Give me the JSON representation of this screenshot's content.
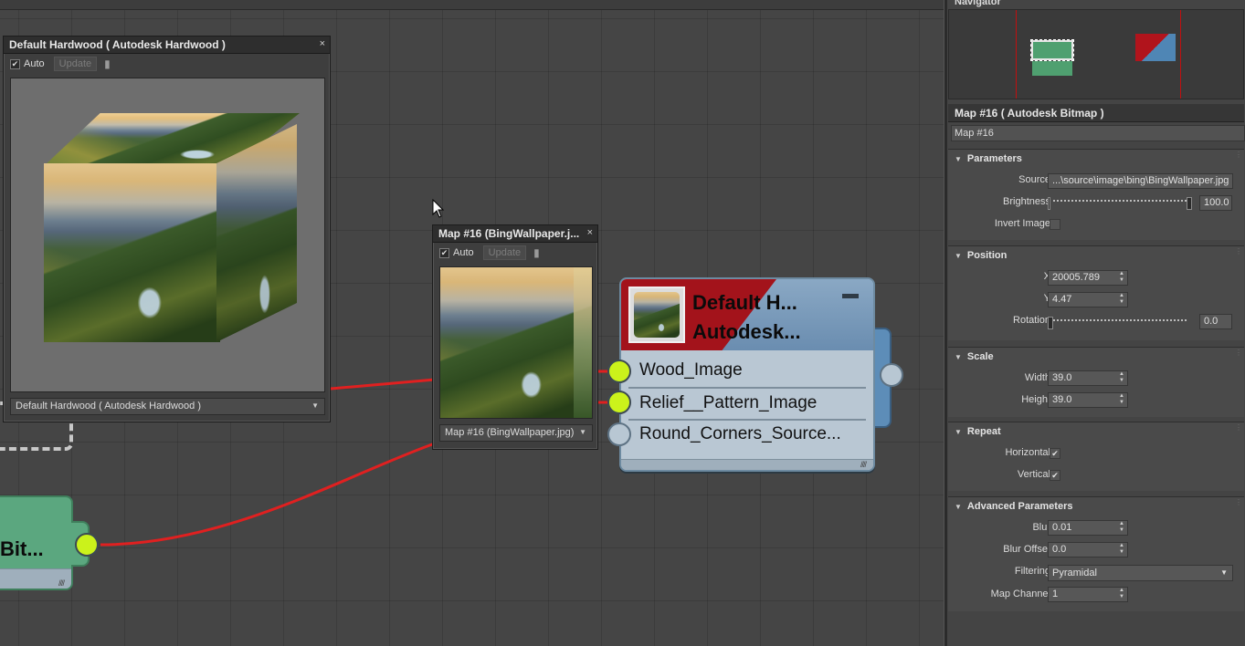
{
  "colors": {
    "wire_red": "#e02020",
    "socket_green": "#cbf21b",
    "node_red": "#a3131b",
    "node_blue": "#6a8db0",
    "bitmap_node_green": "#5ba77f"
  },
  "canvas": {
    "preview_hardwood": {
      "title": "Default Hardwood  ( Autodesk Hardwood )",
      "auto_checked": "✔",
      "auto_label": "Auto",
      "update_label": "Update",
      "dropdown_value": "Default Hardwood  ( Autodesk Hardwood )",
      "close": "×"
    },
    "preview_map16": {
      "title": "Map #16 (BingWallpaper.j...",
      "auto_checked": "✔",
      "auto_label": "Auto",
      "update_label": "Update",
      "dropdown_value": "Map #16 (BingWallpaper.jpg)",
      "close": "×"
    },
    "node_hardwood": {
      "title_line1": "Default H...",
      "title_line2": "Autodesk...",
      "slots": [
        "Wood_Image",
        "Relief__Pattern_Image",
        "Round_Corners_Source..."
      ]
    },
    "node_bitmap": {
      "title": "Bit..."
    }
  },
  "panel": {
    "navigator_title": "Navigator",
    "material_header": "Map #16  ( Autodesk Bitmap )",
    "material_name": "Map #16",
    "parameters": {
      "title": "Parameters",
      "source_label": "Source",
      "source_value": "...\\source\\image\\bing\\BingWallpaper.jpg",
      "brightness_label": "Brightness",
      "brightness_value": "100.0",
      "brightness_level": 1.0,
      "invert_label": "Invert Image",
      "invert_checked": false
    },
    "position": {
      "title": "Position",
      "x_label": "X",
      "x_value": "20005.789",
      "y_label": "Y",
      "y_value": "4.47",
      "rotation_label": "Rotation",
      "rotation_value": "0.0",
      "rotation_level": 0.0
    },
    "scale": {
      "title": "Scale",
      "width_label": "Width",
      "width_value": "39.0",
      "height_label": "Height",
      "height_value": "39.0"
    },
    "repeat": {
      "title": "Repeat",
      "horizontal_label": "Horizontal",
      "horizontal_checked": "✔",
      "vertical_label": "Vertical",
      "vertical_checked": "✔"
    },
    "advanced": {
      "title": "Advanced Parameters",
      "blur_label": "Blur",
      "blur_value": "0.01",
      "blur_offset_label": "Blur Offset",
      "blur_offset_value": "0.0",
      "filtering_label": "Filtering",
      "filtering_value": "Pyramidal",
      "map_channel_label": "Map Channel",
      "map_channel_value": "1"
    }
  }
}
